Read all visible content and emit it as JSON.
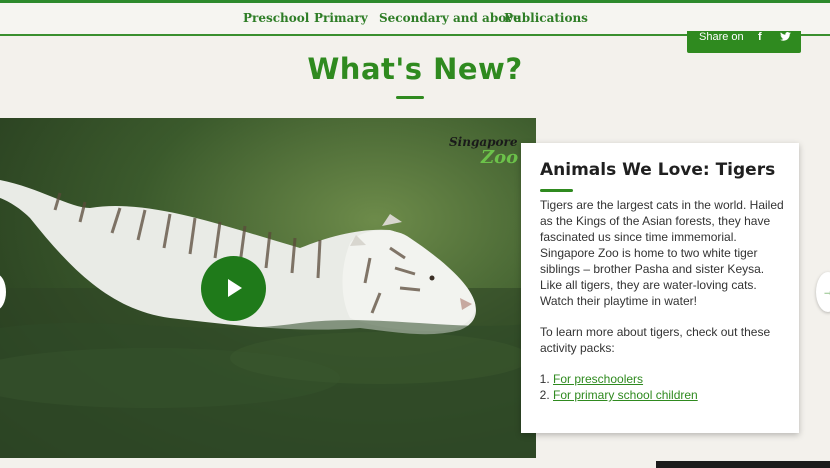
{
  "nav": {
    "items": [
      {
        "label": "Preschool"
      },
      {
        "label": "Primary"
      },
      {
        "label": "Secondary and above"
      },
      {
        "label": "Publications"
      }
    ]
  },
  "share": {
    "label": "Share on",
    "facebook_icon": "f",
    "twitter_icon": "twitter-bird"
  },
  "section": {
    "title": "What's New?"
  },
  "video": {
    "logo_line1": "Singapore",
    "logo_line2": "Zoo",
    "play_icon": "play-icon"
  },
  "card": {
    "title": "Animals We Love: Tigers",
    "paragraph1": "Tigers are the largest cats in the world. Hailed as the Kings of the Asian forests, they have fascinated us since time immemorial. Singapore Zoo is home to two white tiger siblings – brother Pasha and sister Keysa. Like all tigers, they are water-loving cats. Watch their playtime in water!",
    "paragraph2": "To learn more about tigers, check out these activity packs:",
    "links": [
      {
        "label": "For preschoolers"
      },
      {
        "label": "For primary school children"
      }
    ]
  },
  "colors": {
    "accent": "#2f8a1f",
    "background": "#f3f1ec"
  }
}
